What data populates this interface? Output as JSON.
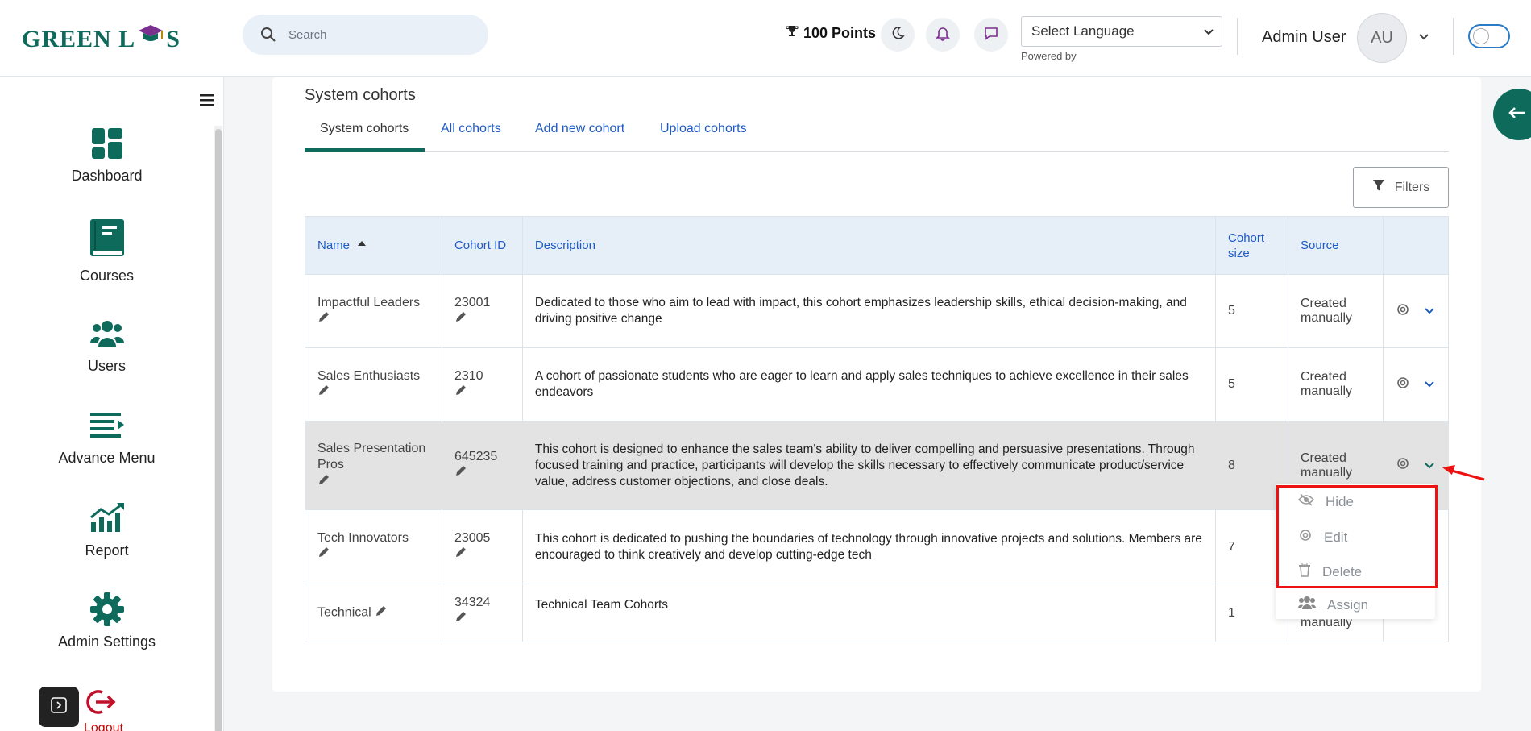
{
  "header": {
    "logo_text_left": "GREEN L",
    "logo_text_right": "S",
    "search_placeholder": "Search",
    "points": "100 Points",
    "language_select": "Select Language",
    "powered_by": "Powered by",
    "user_name": "Admin User",
    "avatar_initials": "AU"
  },
  "sidebar": {
    "items": [
      {
        "label": "Dashboard",
        "icon": "dashboard-icon"
      },
      {
        "label": "Courses",
        "icon": "book-icon"
      },
      {
        "label": "Users",
        "icon": "users-icon"
      },
      {
        "label": "Advance Menu",
        "icon": "menu-lines-icon"
      },
      {
        "label": "Report",
        "icon": "chart-icon"
      },
      {
        "label": "Admin Settings",
        "icon": "gear-icon"
      }
    ],
    "logout_label": "Logout"
  },
  "main": {
    "page_title": "System cohorts",
    "tabs": [
      {
        "label": "System cohorts",
        "active": true
      },
      {
        "label": "All cohorts"
      },
      {
        "label": "Add new cohort"
      },
      {
        "label": "Upload cohorts"
      }
    ],
    "filters_label": "Filters",
    "table": {
      "columns": [
        "Name",
        "Cohort ID",
        "Description",
        "Cohort size",
        "Source"
      ],
      "rows": [
        {
          "name": "Impactful Leaders",
          "id": "23001",
          "description": "Dedicated to those who aim to lead with impact, this cohort emphasizes leadership skills, ethical decision-making, and driving positive change",
          "size": "5",
          "source": "Created manually"
        },
        {
          "name": "Sales Enthusiasts",
          "id": "2310",
          "description": "A cohort of passionate students who are eager to learn and apply sales techniques to achieve excellence in their sales endeavors",
          "size": "5",
          "source": "Created manually"
        },
        {
          "name": "Sales Presentation Pros",
          "id": "645235",
          "description": "This cohort is designed to enhance the sales team's ability to deliver compelling and persuasive presentations. Through focused training and practice, participants will develop the skills necessary to effectively communicate product/service value, address customer objections, and close deals.",
          "size": "8",
          "source": "Created manually"
        },
        {
          "name": "Tech Innovators",
          "id": "23005",
          "description": "This cohort is dedicated to pushing the boundaries of technology through innovative projects and solutions. Members are encouraged to think creatively and develop cutting-edge tech",
          "size": "7",
          "source": ""
        },
        {
          "name": "Technical",
          "id": "34324",
          "description": "Technical Team Cohorts",
          "size": "1",
          "source": "manually"
        }
      ]
    },
    "action_menu": [
      {
        "label": "Hide",
        "icon": "eye-slash-icon"
      },
      {
        "label": "Edit",
        "icon": "gear-icon"
      },
      {
        "label": "Delete",
        "icon": "trash-icon"
      },
      {
        "label": "Assign",
        "icon": "users-icon"
      }
    ]
  },
  "colors": {
    "brand": "#0e6b5c",
    "link": "#1e5bc6",
    "highlight_box": "#ee1111"
  }
}
